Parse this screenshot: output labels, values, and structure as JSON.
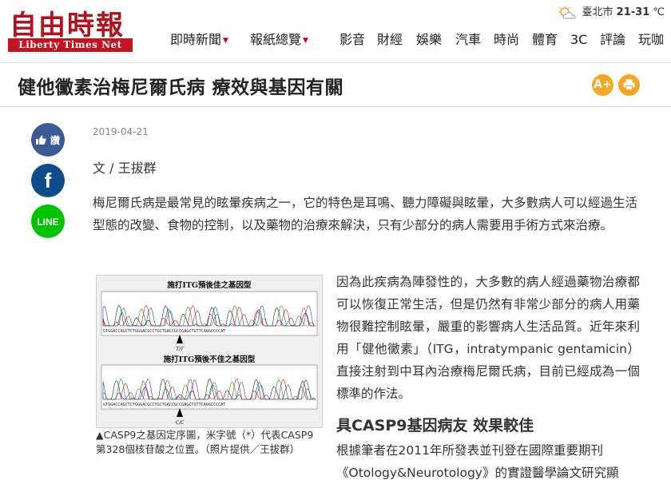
{
  "header": {
    "logo_cn": "自由時報",
    "logo_en": "Liberty Times Net",
    "nav": [
      {
        "label": "即時新聞",
        "dropdown": true
      },
      {
        "label": "報紙總覽",
        "dropdown": true
      },
      {
        "label": "影音",
        "dropdown": false
      },
      {
        "label": "財經",
        "dropdown": false
      },
      {
        "label": "娛樂",
        "dropdown": false
      },
      {
        "label": "汽車",
        "dropdown": false
      },
      {
        "label": "時尚",
        "dropdown": false
      },
      {
        "label": "體育",
        "dropdown": false
      },
      {
        "label": "3C",
        "dropdown": false
      },
      {
        "label": "評論",
        "dropdown": false
      },
      {
        "label": "玩咖",
        "dropdown": false
      }
    ],
    "weather": {
      "city": "臺北市",
      "temp": "21-31",
      "unit": "℃"
    }
  },
  "article": {
    "title": "健他黴素治梅尼爾氏病 療效與基因有關",
    "date": "2019-04-21",
    "author": "文 / 王拔群",
    "para1": "梅尼爾氏病是最常見的眩暈疾病之一，它的特色是耳鳴、聽力障礙與眩暈，大多數病人可以經過生活型態的改變、食物的控制，以及藥物的治療來解決，只有少部分的病人需要用手術方式來治療。",
    "figure": {
      "label_top": "施打ITG預後佳之基因型",
      "label_bottom": "施打ITG預後不佳之基因型",
      "seq": "GTGGACCAGCTCTGGGACGCCTGCTGACCGCCGAGCTGTTCAGGCCCCAT",
      "mark_top": "T/T",
      "mark_bottom": "C/C",
      "caption": "▲CASP9之基因定序圖，米字號（*）代表CASP9第328個核苷酸之位置。（照片提供／王拔群）"
    },
    "para2": "因為此疾病為陣發性的，大多數的病人經過藥物治療都可以恢復正常生活，但是仍然有非常少部分的病人用藥物很難控制眩暈，嚴重的影響病人生活品質。近年來利用「健他黴素」（ITG，intratympanic gentamicin）直接注射到中耳內治療梅尼爾氏病，目前已經成為一個標準的作法。",
    "subhead": "具CASP9基因病友 效果較佳",
    "para3": "根據筆者在2011年所發表並刊登在國際重要期刊《Otology&Neurotology》的實證醫學論文研究顯"
  },
  "controls": {
    "font_label": "A+"
  },
  "social": {
    "like_label": "讚",
    "line_label": "LINE",
    "fb_label": "f"
  },
  "colors": {
    "brand_red": "#c4121e",
    "orange": "#f5a623",
    "line_green": "#00c300",
    "fb_blue": "#3b5998"
  }
}
